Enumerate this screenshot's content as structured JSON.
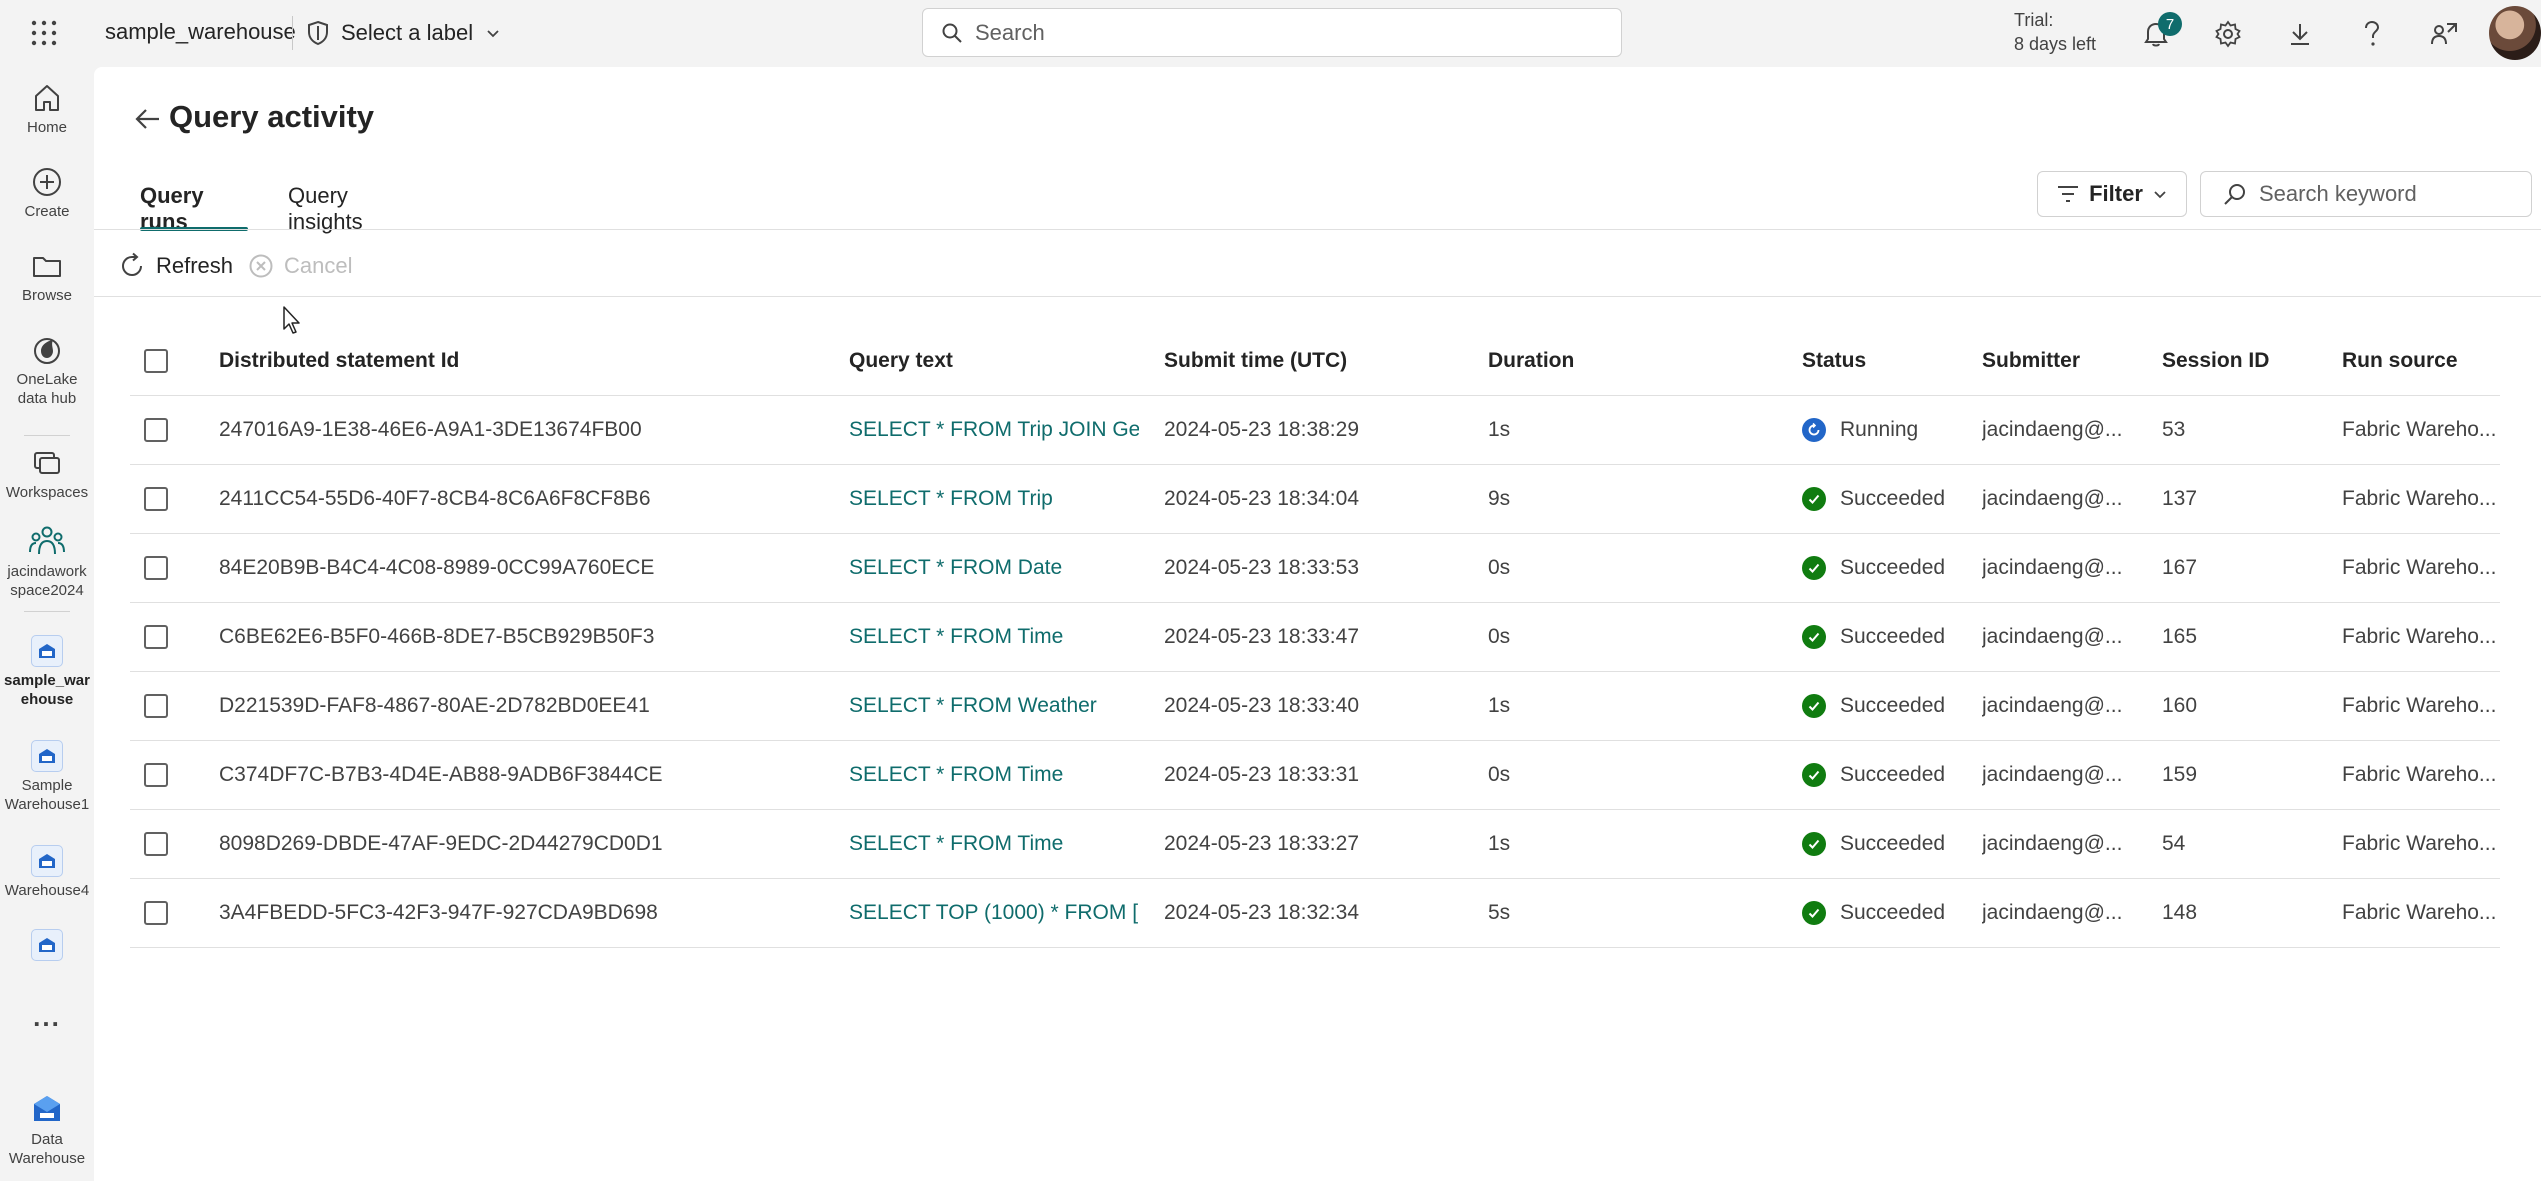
{
  "header": {
    "workspace_name": "sample_warehouse",
    "label_picker": "Select a label",
    "search_placeholder": "Search",
    "trial_line1": "Trial:",
    "trial_line2": "8 days left",
    "notification_count": "7"
  },
  "rail": {
    "items": [
      {
        "label": "Home",
        "icon": "home-icon"
      },
      {
        "label": "Create",
        "icon": "plus-circle-icon"
      },
      {
        "label": "Browse",
        "icon": "folder-icon"
      },
      {
        "label": "OneLake data hub",
        "icon": "onelake-icon"
      },
      {
        "label": "Workspaces",
        "icon": "workspaces-icon"
      },
      {
        "label": "jacindawork space2024",
        "icon": "group-icon"
      },
      {
        "label": "sample_war ehouse",
        "icon": "warehouse-icon"
      },
      {
        "label": "Sample Warehouse1",
        "icon": "warehouse-icon"
      },
      {
        "label": "Warehouse4",
        "icon": "warehouse-icon"
      },
      {
        "label": "Data Warehouse",
        "icon": "data-warehouse-icon"
      }
    ],
    "more_label": "..."
  },
  "page": {
    "title": "Query activity",
    "tabs": [
      {
        "label": "Query runs",
        "active": true
      },
      {
        "label": "Query insights",
        "active": false
      }
    ],
    "filter_label": "Filter",
    "keyword_placeholder": "Search keyword",
    "refresh_label": "Refresh",
    "cancel_label": "Cancel"
  },
  "table": {
    "columns": [
      "Distributed statement Id",
      "Query text",
      "Submit time (UTC)",
      "Duration",
      "Status",
      "Submitter",
      "Session ID",
      "Run source"
    ],
    "rows": [
      {
        "id": "247016A9-1E38-46E6-A9A1-3DE13674FB00",
        "query": "SELECT * FROM Trip JOIN Ge...",
        "submit": "2024-05-23 18:38:29",
        "duration": "1s",
        "status": "Running",
        "submitter": "jacindaeng@...",
        "session": "53",
        "source": "Fabric Wareho..."
      },
      {
        "id": "2411CC54-55D6-40F7-8CB4-8C6A6F8CF8B6",
        "query": "SELECT * FROM Trip",
        "submit": "2024-05-23 18:34:04",
        "duration": "9s",
        "status": "Succeeded",
        "submitter": "jacindaeng@...",
        "session": "137",
        "source": "Fabric Wareho..."
      },
      {
        "id": "84E20B9B-B4C4-4C08-8989-0CC99A760ECE",
        "query": "SELECT * FROM Date",
        "submit": "2024-05-23 18:33:53",
        "duration": "0s",
        "status": "Succeeded",
        "submitter": "jacindaeng@...",
        "session": "167",
        "source": "Fabric Wareho..."
      },
      {
        "id": "C6BE62E6-B5F0-466B-8DE7-B5CB929B50F3",
        "query": "SELECT * FROM Time",
        "submit": "2024-05-23 18:33:47",
        "duration": "0s",
        "status": "Succeeded",
        "submitter": "jacindaeng@...",
        "session": "165",
        "source": "Fabric Wareho..."
      },
      {
        "id": "D221539D-FAF8-4867-80AE-2D782BD0EE41",
        "query": "SELECT * FROM Weather",
        "submit": "2024-05-23 18:33:40",
        "duration": "1s",
        "status": "Succeeded",
        "submitter": "jacindaeng@...",
        "session": "160",
        "source": "Fabric Wareho..."
      },
      {
        "id": "C374DF7C-B7B3-4D4E-AB88-9ADB6F3844CE",
        "query": "SELECT * FROM Time",
        "submit": "2024-05-23 18:33:31",
        "duration": "0s",
        "status": "Succeeded",
        "submitter": "jacindaeng@...",
        "session": "159",
        "source": "Fabric Wareho..."
      },
      {
        "id": "8098D269-DBDE-47AF-9EDC-2D44279CD0D1",
        "query": "SELECT * FROM Time",
        "submit": "2024-05-23 18:33:27",
        "duration": "1s",
        "status": "Succeeded",
        "submitter": "jacindaeng@...",
        "session": "54",
        "source": "Fabric Wareho..."
      },
      {
        "id": "3A4FBEDD-5FC3-42F3-947F-927CDA9BD698",
        "query": "SELECT TOP (1000) * FROM [...",
        "submit": "2024-05-23 18:32:34",
        "duration": "5s",
        "status": "Succeeded",
        "submitter": "jacindaeng@...",
        "session": "148",
        "source": "Fabric Wareho..."
      }
    ]
  },
  "colors": {
    "accent": "#0f6c6c",
    "running": "#2266c8",
    "succeeded": "#107c10"
  }
}
